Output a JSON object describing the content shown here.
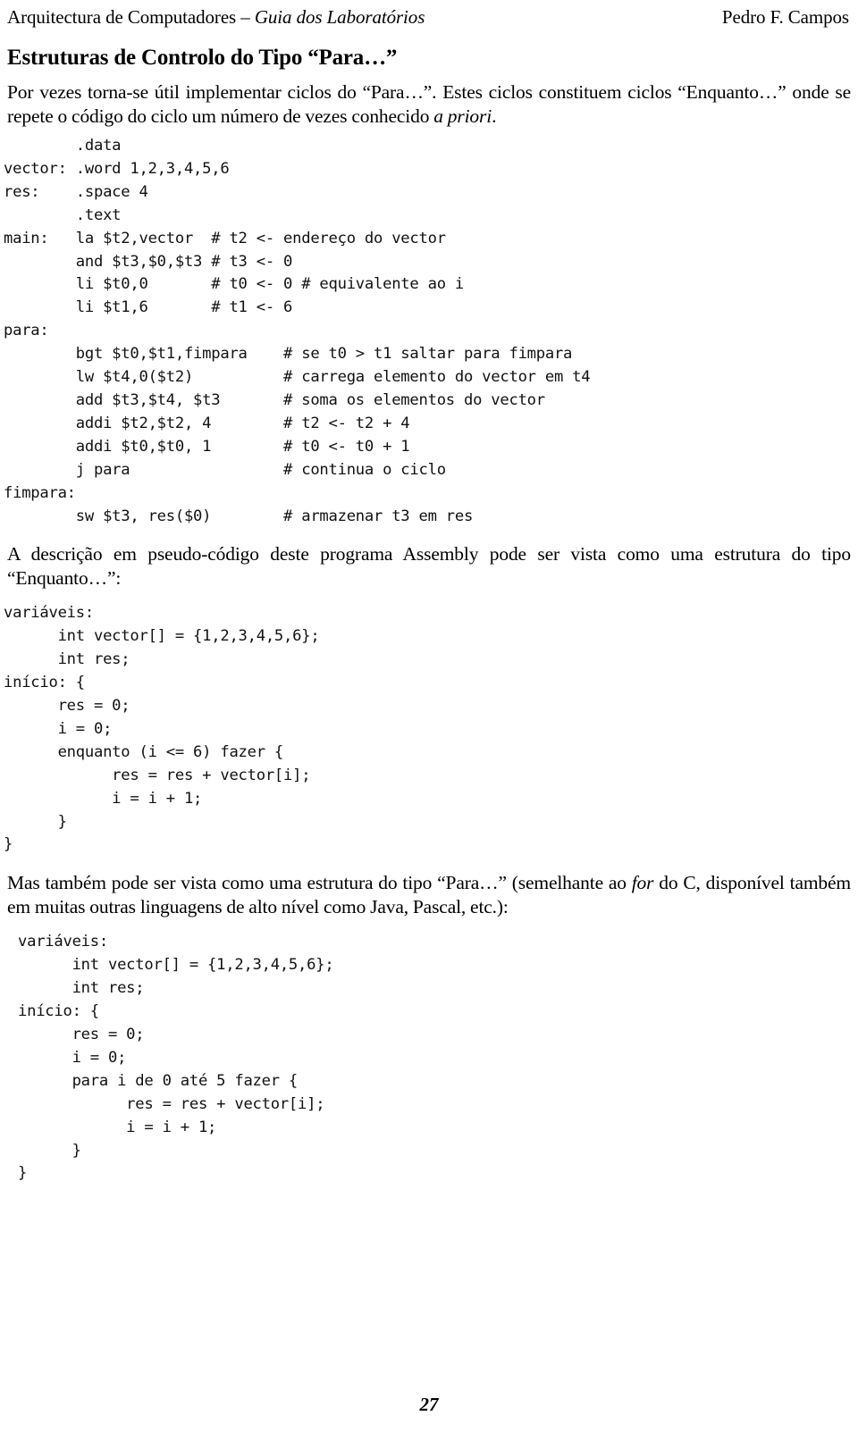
{
  "header": {
    "left_plain": "Arquitectura de Computadores – ",
    "left_italic": "Guia dos Laboratórios",
    "right": "Pedro F. Campos"
  },
  "section": {
    "title": "Estruturas de Controlo do Tipo “Para…”"
  },
  "paragraphs": {
    "intro_part1": "Por vezes torna-se útil implementar ciclos do “Para…”. Estes ciclos constituem ciclos “Enquanto…” onde se repete o código do ciclo um número de vezes conhecido ",
    "intro_italic": "a priori",
    "intro_part2": ".",
    "after_asm": "A descrição em pseudo-código deste programa Assembly pode ser vista como uma estrutura do tipo “Enquanto…”:",
    "after_pseudo1_part1": "Mas também pode ser vista como uma estrutura do tipo “Para…” (semelhante ao ",
    "after_pseudo1_italic": "for",
    "after_pseudo1_part2": " do C, disponível também em muitas outras linguagens de alto nível como Java, Pascal, etc.):"
  },
  "code_blocks": {
    "assembly": {
      "language": "MIPS Assembly",
      "lines": [
        "        .data",
        "vector: .word 1,2,3,4,5,6",
        "res:    .space 4",
        "        .text",
        "main:   la $t2,vector  # t2 <- endereço do vector",
        "        and $t3,$0,$t3 # t3 <- 0",
        "        li $t0,0       # t0 <- 0 # equivalente ao i",
        "        li $t1,6       # t1 <- 6",
        "para:",
        "        bgt $t0,$t1,fimpara    # se t0 > t1 saltar para fimpara",
        "        lw $t4,0($t2)          # carrega elemento do vector em t4",
        "        add $t3,$t4, $t3       # soma os elementos do vector",
        "        addi $t2,$t2, 4        # t2 <- t2 + 4",
        "        addi $t0,$t0, 1        # t0 <- t0 + 1",
        "        j para                 # continua o ciclo",
        "fimpara:",
        "        sw $t3, res($0)        # armazenar t3 em res"
      ]
    },
    "pseudo_enquanto": {
      "language": "pseudo-código",
      "lines": [
        "variáveis:",
        "      int vector[] = {1,2,3,4,5,6};",
        "      int res;",
        "início: {",
        "      res = 0;",
        "      i = 0;",
        "      enquanto (i <= 6) fazer {",
        "            res = res + vector[i];",
        "            i = i + 1;",
        "      }",
        "}"
      ]
    },
    "pseudo_para": {
      "language": "pseudo-código",
      "lines": [
        "variáveis:",
        "      int vector[] = {1,2,3,4,5,6};",
        "      int res;",
        "início: {",
        "      res = 0;",
        "      i = 0;",
        "      para i de 0 até 5 fazer {",
        "            res = res + vector[i];",
        "            i = i + 1;",
        "      }",
        "}"
      ]
    }
  },
  "footer": {
    "page_number": "27"
  }
}
